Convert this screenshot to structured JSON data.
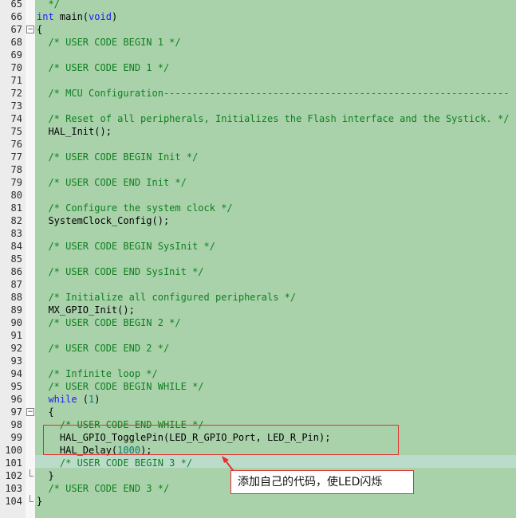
{
  "editor": {
    "lines": [
      {
        "n": "65",
        "parts": [
          {
            "t": "  */",
            "c": "comment"
          }
        ]
      },
      {
        "n": "66",
        "parts": [
          {
            "t": "int",
            "c": "kw"
          },
          {
            "t": " main(",
            "c": "plain"
          },
          {
            "t": "void",
            "c": "kw"
          },
          {
            "t": ")",
            "c": "plain"
          }
        ]
      },
      {
        "n": "67",
        "parts": [
          {
            "t": "{",
            "c": "plain"
          }
        ],
        "fold": "open"
      },
      {
        "n": "68",
        "parts": [
          {
            "t": "  /* USER CODE BEGIN 1 */",
            "c": "comment"
          }
        ]
      },
      {
        "n": "69",
        "parts": []
      },
      {
        "n": "70",
        "parts": [
          {
            "t": "  /* USER CODE END 1 */",
            "c": "comment"
          }
        ]
      },
      {
        "n": "71",
        "parts": []
      },
      {
        "n": "72",
        "parts": [
          {
            "t": "  /* MCU Configuration------------------------------------------------------------",
            "c": "comment"
          }
        ]
      },
      {
        "n": "73",
        "parts": []
      },
      {
        "n": "74",
        "parts": [
          {
            "t": "  /* Reset of all peripherals, Initializes the Flash interface and the Systick. */",
            "c": "comment"
          }
        ]
      },
      {
        "n": "75",
        "parts": [
          {
            "t": "  HAL_Init();",
            "c": "plain"
          }
        ]
      },
      {
        "n": "76",
        "parts": []
      },
      {
        "n": "77",
        "parts": [
          {
            "t": "  /* USER CODE BEGIN Init */",
            "c": "comment"
          }
        ]
      },
      {
        "n": "78",
        "parts": []
      },
      {
        "n": "79",
        "parts": [
          {
            "t": "  /* USER CODE END Init */",
            "c": "comment"
          }
        ]
      },
      {
        "n": "80",
        "parts": []
      },
      {
        "n": "81",
        "parts": [
          {
            "t": "  /* Configure the system clock */",
            "c": "comment"
          }
        ]
      },
      {
        "n": "82",
        "parts": [
          {
            "t": "  SystemClock_Config();",
            "c": "plain"
          }
        ]
      },
      {
        "n": "83",
        "parts": []
      },
      {
        "n": "84",
        "parts": [
          {
            "t": "  /* USER CODE BEGIN SysInit */",
            "c": "comment"
          }
        ]
      },
      {
        "n": "85",
        "parts": []
      },
      {
        "n": "86",
        "parts": [
          {
            "t": "  /* USER CODE END SysInit */",
            "c": "comment"
          }
        ]
      },
      {
        "n": "87",
        "parts": []
      },
      {
        "n": "88",
        "parts": [
          {
            "t": "  /* Initialize all configured peripherals */",
            "c": "comment"
          }
        ]
      },
      {
        "n": "89",
        "parts": [
          {
            "t": "  MX_GPIO_Init();",
            "c": "plain"
          }
        ]
      },
      {
        "n": "90",
        "parts": [
          {
            "t": "  /* USER CODE BEGIN 2 */",
            "c": "comment"
          }
        ]
      },
      {
        "n": "91",
        "parts": []
      },
      {
        "n": "92",
        "parts": [
          {
            "t": "  /* USER CODE END 2 */",
            "c": "comment"
          }
        ]
      },
      {
        "n": "93",
        "parts": []
      },
      {
        "n": "94",
        "parts": [
          {
            "t": "  /* Infinite loop */",
            "c": "comment"
          }
        ]
      },
      {
        "n": "95",
        "parts": [
          {
            "t": "  /* USER CODE BEGIN WHILE */",
            "c": "comment"
          }
        ]
      },
      {
        "n": "96",
        "parts": [
          {
            "t": "  ",
            "c": "plain"
          },
          {
            "t": "while",
            "c": "kw"
          },
          {
            "t": " (",
            "c": "plain"
          },
          {
            "t": "1",
            "c": "num"
          },
          {
            "t": ")",
            "c": "plain"
          }
        ]
      },
      {
        "n": "97",
        "parts": [
          {
            "t": "  {",
            "c": "plain"
          }
        ],
        "fold": "open"
      },
      {
        "n": "98",
        "parts": [
          {
            "t": "    /* USER CODE END WHILE */",
            "c": "comment"
          }
        ]
      },
      {
        "n": "99",
        "parts": [
          {
            "t": "    HAL_GPIO_TogglePin(LED_R_GPIO_Port, LED_R_Pin);",
            "c": "plain"
          }
        ]
      },
      {
        "n": "100",
        "parts": [
          {
            "t": "    HAL_Delay(",
            "c": "plain"
          },
          {
            "t": "1000",
            "c": "num"
          },
          {
            "t": ");",
            "c": "plain"
          }
        ]
      },
      {
        "n": "101",
        "parts": [
          {
            "t": "    /* USER CODE BEGIN 3 */",
            "c": "comment"
          }
        ]
      },
      {
        "n": "102",
        "parts": [
          {
            "t": "  }",
            "c": "plain"
          }
        ],
        "fold": "end"
      },
      {
        "n": "103",
        "parts": [
          {
            "t": "  /* USER CODE END 3 */",
            "c": "comment"
          }
        ]
      },
      {
        "n": "104",
        "parts": [
          {
            "t": "}",
            "c": "plain"
          }
        ],
        "fold": "end"
      }
    ]
  },
  "annotation": {
    "callout_text": "添加自己的代码，使LED闪烁",
    "accent_color": "#e53030"
  },
  "colors": {
    "code_background": "#a9d2aa",
    "comment": "#0f7f20",
    "keyword": "#1c1cff",
    "number": "#0a7a7a"
  }
}
